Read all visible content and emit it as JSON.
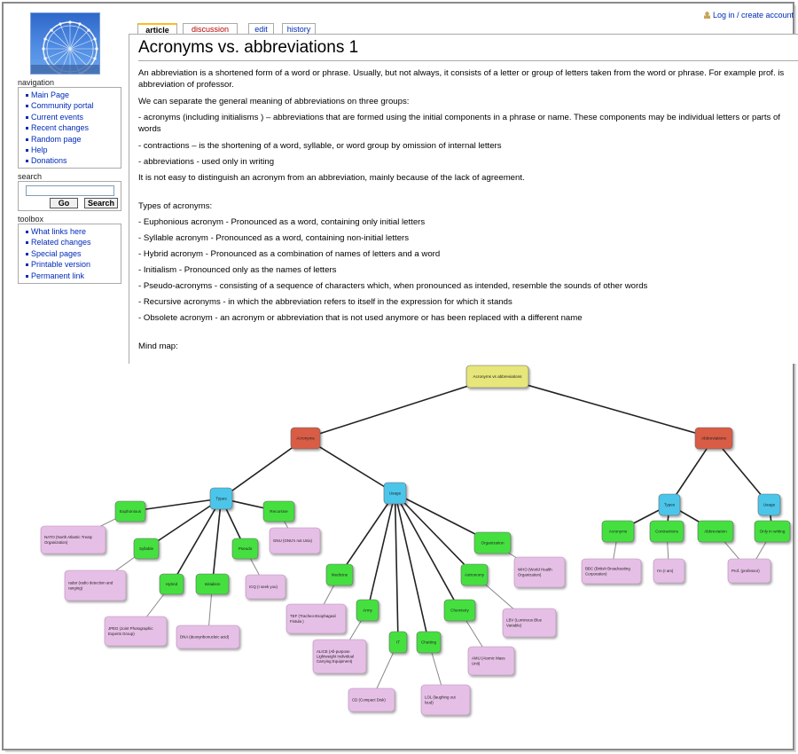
{
  "header": {
    "login_link": "Log in / create account",
    "tabs": [
      {
        "label": "article",
        "state": "selected"
      },
      {
        "label": "discussion",
        "state": "new"
      },
      {
        "label": "edit",
        "state": "normal"
      },
      {
        "label": "history",
        "state": "normal"
      }
    ]
  },
  "sidebar": {
    "navigation": {
      "title": "navigation",
      "items": [
        "Main Page",
        "Community portal",
        "Current events",
        "Recent changes",
        "Random page",
        "Help",
        "Donations"
      ]
    },
    "search": {
      "title": "search",
      "go_label": "Go",
      "search_label": "Search"
    },
    "toolbox": {
      "title": "toolbox",
      "items": [
        "What links here",
        "Related changes",
        "Special pages",
        "Printable version",
        "Permanent link"
      ]
    }
  },
  "article": {
    "title": "Acronyms vs. abbreviations 1",
    "paragraphs": [
      "An abbreviation is a shortened form of a word or phrase. Usually, but not always, it consists of a letter or group of letters taken from the word or phrase. For example prof. is abbreviation of professor.",
      "We can separate the general meaning of abbreviations on three groups:",
      "- acronyms (including initialisms ) – abbreviations that are formed using the initial components in a phrase or name. These components may be individual letters or parts of words",
      "- contractions – is the shortening of a word, syllable, or word group by omission of internal letters",
      "- abbreviations - used only in writing",
      "It is not easy to distinguish an acronym from an abbreviation, mainly because of the lack of agreement.",
      "Types of acronyms:",
      "- Euphonious acronym - Pronounced as a word, containing only initial letters",
      "- Syllable acronym - Pronounced as a word, containing non-initial letters",
      "- Hybrid acronym - Pronounced as a combination of names of letters and a word",
      "- Initialism - Pronounced only as the names of letters",
      "- Pseudo-acronyms - consisting of a sequence of characters which, when pronounced as intended, resemble the sounds of other words",
      "- Recursive acronyms - in which the abbreviation refers to itself in the expression for which it stands",
      "- Obsolete acronym - an acronym or abbreviation that is not used anymore or has been replaced with a different name",
      "Mind map:"
    ]
  },
  "mindmap": {
    "colors": {
      "root": "#e6e67a",
      "category": "#d95c45",
      "hub": "#4cc6ea",
      "leaf": "#44e040",
      "example": "#e6bfe6",
      "edge": "#222222"
    },
    "nodes": [
      {
        "id": "root",
        "label": "Acronyms vs abbreviations",
        "kind": "root"
      },
      {
        "id": "acr",
        "label": "Acronyms",
        "kind": "category"
      },
      {
        "id": "abb",
        "label": "Abbreviations",
        "kind": "category"
      },
      {
        "id": "types1",
        "label": "Types",
        "kind": "hub"
      },
      {
        "id": "usage1",
        "label": "Usage",
        "kind": "hub"
      },
      {
        "id": "types2",
        "label": "Types",
        "kind": "hub"
      },
      {
        "id": "usage2",
        "label": "Usage",
        "kind": "hub"
      },
      {
        "id": "euph",
        "label": "Euphonious",
        "kind": "leaf"
      },
      {
        "id": "syll",
        "label": "Syllable",
        "kind": "leaf"
      },
      {
        "id": "hyb",
        "label": "Hybrid",
        "kind": "leaf"
      },
      {
        "id": "init",
        "label": "Initialism",
        "kind": "leaf"
      },
      {
        "id": "pseu",
        "label": "Pseudo",
        "kind": "leaf"
      },
      {
        "id": "recu",
        "label": "Recursive",
        "kind": "leaf"
      },
      {
        "id": "nato",
        "label": "NATO (North Atlantic Treaty Organization)",
        "kind": "example"
      },
      {
        "id": "radar",
        "label": "radar (radio detection and ranging)",
        "kind": "example"
      },
      {
        "id": "jpeg",
        "label": "JPEG (Joint Photographic Experts Group)",
        "kind": "example"
      },
      {
        "id": "dna",
        "label": "DNA (deoxyribonucleic acid)",
        "kind": "example"
      },
      {
        "id": "icq",
        "label": "ICQ (I seek you)",
        "kind": "example"
      },
      {
        "id": "gnu",
        "label": "GNU (GNU's not Unix)",
        "kind": "example"
      },
      {
        "id": "med",
        "label": "Medicine",
        "kind": "leaf"
      },
      {
        "id": "army",
        "label": "Army",
        "kind": "leaf"
      },
      {
        "id": "it",
        "label": "IT",
        "kind": "leaf"
      },
      {
        "id": "chat",
        "label": "Chatting",
        "kind": "leaf"
      },
      {
        "id": "chem",
        "label": "Chemistry",
        "kind": "leaf"
      },
      {
        "id": "astr",
        "label": "Astronomy",
        "kind": "leaf"
      },
      {
        "id": "org",
        "label": "Organization",
        "kind": "leaf"
      },
      {
        "id": "tef",
        "label": "TEF (Tracheo-Esophageal Fistula )",
        "kind": "example"
      },
      {
        "id": "alice",
        "label": "ALICE (All-purpose Lightweight Individual Carrying Equipment)",
        "kind": "example"
      },
      {
        "id": "cd",
        "label": "CD (Compact Disk)",
        "kind": "example"
      },
      {
        "id": "lol",
        "label": "LOL (laughing out loud)",
        "kind": "example"
      },
      {
        "id": "amu",
        "label": "AMU (Atomic Mass Unit)",
        "kind": "example"
      },
      {
        "id": "lbv",
        "label": "LBV (Luminous Blue Variable)",
        "kind": "example"
      },
      {
        "id": "who",
        "label": "WHO (World Health Organization)",
        "kind": "example"
      },
      {
        "id": "acr2",
        "label": "Acronyms",
        "kind": "leaf"
      },
      {
        "id": "contr",
        "label": "Contractions",
        "kind": "leaf"
      },
      {
        "id": "abbr2",
        "label": "Abbreviation",
        "kind": "leaf"
      },
      {
        "id": "oiw",
        "label": "Only in writing",
        "kind": "leaf"
      },
      {
        "id": "bbc",
        "label": "BBC (British Broadcasting Corporation)",
        "kind": "example"
      },
      {
        "id": "im",
        "label": "I'm (I am)",
        "kind": "example"
      },
      {
        "id": "prof",
        "label": "Prof. (professor)",
        "kind": "example"
      }
    ],
    "edges": [
      [
        "root",
        "acr"
      ],
      [
        "root",
        "abb"
      ],
      [
        "acr",
        "types1"
      ],
      [
        "acr",
        "usage1"
      ],
      [
        "types1",
        "euph"
      ],
      [
        "types1",
        "syll"
      ],
      [
        "types1",
        "hyb"
      ],
      [
        "types1",
        "init"
      ],
      [
        "types1",
        "pseu"
      ],
      [
        "types1",
        "recu"
      ],
      [
        "euph",
        "nato"
      ],
      [
        "syll",
        "radar"
      ],
      [
        "hyb",
        "jpeg"
      ],
      [
        "init",
        "dna"
      ],
      [
        "pseu",
        "icq"
      ],
      [
        "recu",
        "gnu"
      ],
      [
        "usage1",
        "med"
      ],
      [
        "usage1",
        "army"
      ],
      [
        "usage1",
        "it"
      ],
      [
        "usage1",
        "chat"
      ],
      [
        "usage1",
        "chem"
      ],
      [
        "usage1",
        "astr"
      ],
      [
        "usage1",
        "org"
      ],
      [
        "med",
        "tef"
      ],
      [
        "army",
        "alice"
      ],
      [
        "it",
        "cd"
      ],
      [
        "chat",
        "lol"
      ],
      [
        "chem",
        "amu"
      ],
      [
        "astr",
        "lbv"
      ],
      [
        "org",
        "who"
      ],
      [
        "abb",
        "types2"
      ],
      [
        "abb",
        "usage2"
      ],
      [
        "types2",
        "acr2"
      ],
      [
        "types2",
        "contr"
      ],
      [
        "types2",
        "abbr2"
      ],
      [
        "usage2",
        "oiw"
      ],
      [
        "acr2",
        "bbc"
      ],
      [
        "contr",
        "im"
      ],
      [
        "abbr2",
        "prof"
      ],
      [
        "oiw",
        "prof"
      ]
    ]
  }
}
